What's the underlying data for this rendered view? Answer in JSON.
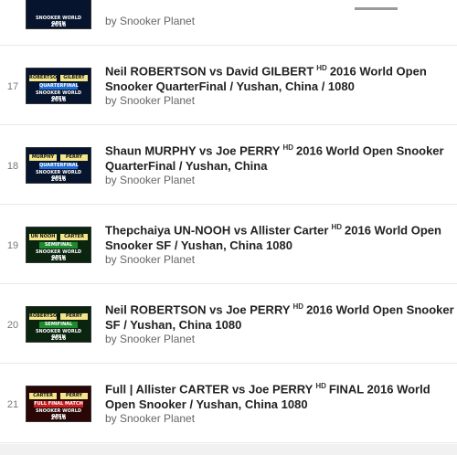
{
  "playlist": {
    "items": [
      {
        "index": "",
        "title_pre": "",
        "hd": "",
        "title_post": "",
        "channel": "by Snooker Planet",
        "thumb": {
          "top": "",
          "p1": "",
          "p2": "",
          "stage": "",
          "event": "SNOOKER WORLD OPEN",
          "year": "2016",
          "stage_color": "#1a1a1a",
          "bg": "#0b0b0b"
        }
      },
      {
        "index": "17",
        "title_pre": "Neil ROBERTSON vs David GILBERT",
        "hd": "HD",
        "title_post": "2016 World Open Snooker QuarterFinal / Yushan, China / 1080",
        "channel": "by Snooker Planet",
        "thumb": {
          "top": "ROBERTSON   GILBERT",
          "p1": "ROBERTSON",
          "p2": "GILBERT",
          "stage": "QUARTERFINAL",
          "event": "SNOOKER WORLD OPEN",
          "year": "2016",
          "stage_color": "#1f6ad1",
          "bg": "#06142e"
        }
      },
      {
        "index": "18",
        "title_pre": "Shaun MURPHY vs Joe PERRY",
        "hd": "HD",
        "title_post": "2016 World Open Snooker QuarterFinal / Yushan, China",
        "channel": "by Snooker Planet",
        "thumb": {
          "top": "MURPHY   PERRY",
          "p1": "MURPHY",
          "p2": "PERRY",
          "stage": "QUARTERFINAL",
          "event": "SNOOKER WORLD OPEN",
          "year": "2016",
          "stage_color": "#1f6ad1",
          "bg": "#06142e"
        }
      },
      {
        "index": "19",
        "title_pre": "Thepchaiya UN-NOOH vs Allister Carter",
        "hd": "HD",
        "title_post": "2016 World Open Snooker SF / Yushan, China 1080",
        "channel": "by Snooker Planet",
        "thumb": {
          "top": "UN NOOH   CARTER",
          "p1": "UN NOOH",
          "p2": "CARTER",
          "stage": "SEMIFINAL",
          "event": "SNOOKER WORLD OPEN",
          "year": "2016",
          "stage_color": "#1e8a2e",
          "bg": "#0a2410"
        }
      },
      {
        "index": "20",
        "title_pre": "Neil ROBERTSON vs Joe PERRY",
        "hd": "HD",
        "title_post": "2016 World Open Snooker SF / Yushan, China 1080",
        "channel": "by Snooker Planet",
        "thumb": {
          "top": "ROBERTSON   PERRY",
          "p1": "ROBERTSON",
          "p2": "PERRY",
          "stage": "SEMIFINAL",
          "event": "SNOOKER WORLD OPEN",
          "year": "2016",
          "stage_color": "#1e8a2e",
          "bg": "#0a2410"
        }
      },
      {
        "index": "21",
        "title_pre": "Full | Allister CARTER vs Joe PERRY",
        "hd": "HD",
        "title_post": "FINAL 2016 World Open Snooker / Yushan, China 1080",
        "channel": "by Snooker Planet",
        "thumb": {
          "top": "CARTER   PERRY",
          "p1": "CARTER",
          "p2": "PERRY",
          "stage": "FULL FINAL MATCH",
          "event": "SNOOKER WORLD OPEN",
          "year": "2016",
          "stage_color": "#c41e1e",
          "bg": "#2a0606"
        }
      }
    ]
  }
}
